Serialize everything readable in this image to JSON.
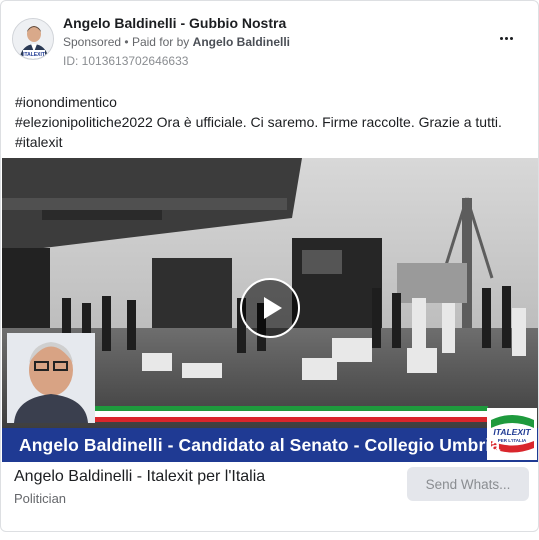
{
  "ad": {
    "page_name": "Angelo Baldinelli - Gubbio Nostra",
    "sponsored_label": "Sponsored",
    "separator": "•",
    "paid_for_prefix": "Paid for by",
    "paid_for_name": "Angelo Baldinelli",
    "id_line": "ID: 1013613702646633",
    "avatar_logo_text": "ITALEXIT"
  },
  "post": {
    "lines": [
      "#ionondimentico",
      "#elezionipolitiche2022 Ora è ufficiale. Ci saremo. Firme raccolte. Grazie a tutti.",
      "#italexit"
    ]
  },
  "media": {
    "banner_text": "Angelo Baldinelli - Candidato al Senato -  Collegio Umbria",
    "logo_line1": "ITALEXIT",
    "logo_line2": "PER L'ITALIA",
    "icon": "play-icon",
    "colors": {
      "banner_blue": "#1f3a93",
      "flag_green": "#1e9a3d",
      "flag_red": "#d9262c"
    }
  },
  "footer": {
    "title": "Angelo Baldinelli - Italexit per l'Italia",
    "subtitle": "Politician",
    "cta_label": "Send Whats..."
  }
}
